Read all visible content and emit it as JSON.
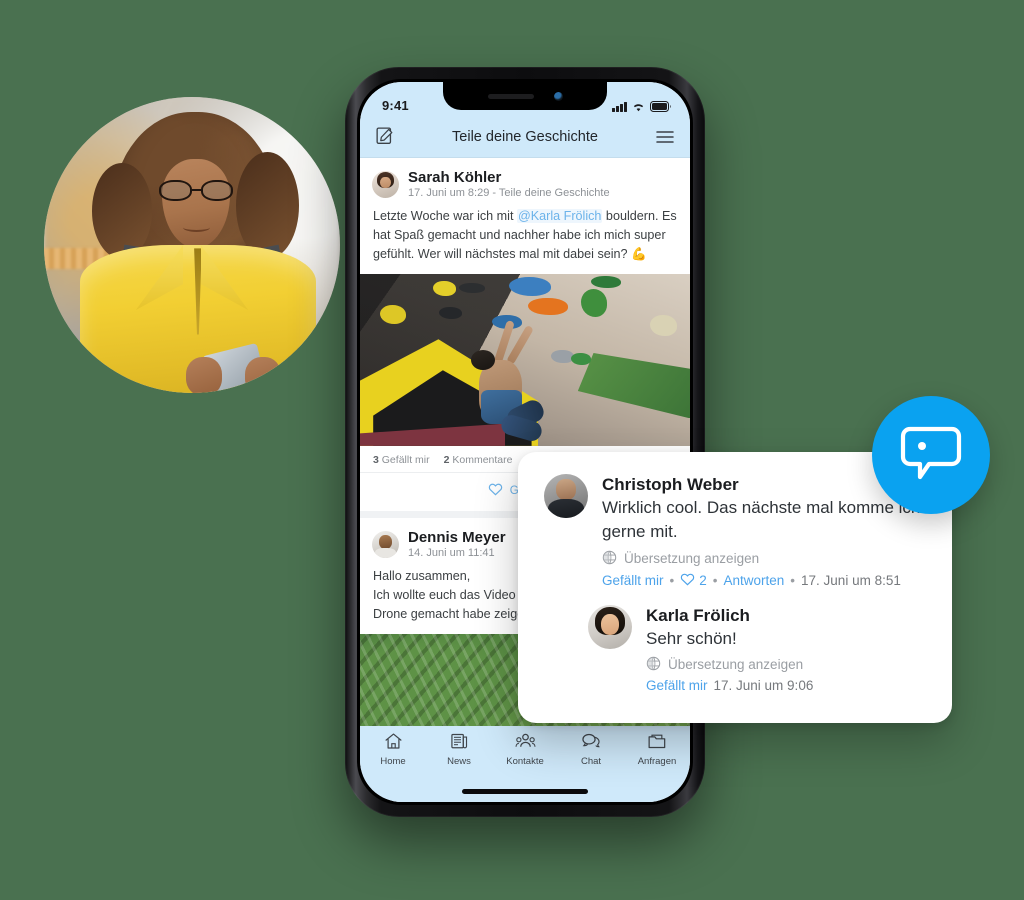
{
  "theme": {
    "page_background": "#4a7150",
    "header_blue": "#cfe9fa",
    "accent_blue": "#4da3ea",
    "fab_blue": "#0aa2f0"
  },
  "photo": {
    "alt": "smiling-woman-with-curly-hair-holding-phone"
  },
  "phone": {
    "status_bar": {
      "time": "9:41",
      "signal_icon": "cellular-bars-icon",
      "wifi_icon": "wifi-icon",
      "battery_icon": "battery-icon"
    },
    "header": {
      "compose_icon": "compose-icon",
      "title": "Teile deine Geschichte",
      "menu_icon": "hamburger-menu-icon"
    },
    "feed": {
      "posts": [
        {
          "author": "Sarah Köhler",
          "meta": "17. Juni um 8:29 - Teile deine Geschichte",
          "text_before": "Letzte Woche war ich mit ",
          "mention": "@Karla Frölich",
          "text_after": " bouldern. Es hat Spaß gemacht und nachher habe ich mich super gefühlt. Wer will nächstes mal mit dabei sein? 💪",
          "image_alt": "bouldering-climbing-wall-photo",
          "likes_count": "3",
          "likes_label": "Gefällt mir",
          "comments_count": "2",
          "comments_label": "Kommentare",
          "action_label": "Gefällt mir",
          "action_icon": "heart-icon"
        },
        {
          "author": "Dennis Meyer",
          "meta": "14. Juni um 11:41",
          "text_line1": "Hallo zusammen,",
          "text_line2": "Ich wollte euch das Video",
          "text_line3": "Drone gemacht habe zeigen",
          "image_alt": "aerial-rice-terraces-photo"
        }
      ]
    },
    "tabbar": [
      {
        "label": "Home",
        "icon": "home-icon"
      },
      {
        "label": "News",
        "icon": "newspaper-icon"
      },
      {
        "label": "Kontakte",
        "icon": "contacts-people-icon"
      },
      {
        "label": "Chat",
        "icon": "chat-bubble-icon"
      },
      {
        "label": "Anfragen",
        "icon": "folder-icon"
      }
    ]
  },
  "comment_card": {
    "comments": [
      {
        "author": "Christoph Weber",
        "text": "Wirklich cool. Das nächste mal komme ich gerne mit.",
        "translate_icon": "globe-icon",
        "translate_label": "Übersetzung anzeigen",
        "like_label": "Gefällt mir",
        "heart_icon": "heart-icon",
        "heart_count": "2",
        "reply_label": "Antworten",
        "timestamp": "17. Juni um 8:51",
        "separator": "•"
      },
      {
        "author": "Karla Frölich",
        "text": "Sehr schön!",
        "translate_icon": "globe-icon",
        "translate_label": "Übersetzung anzeigen",
        "like_label": "Gefällt mir",
        "timestamp": "17. Juni um 9:06"
      }
    ]
  },
  "fab": {
    "icon": "chat-bubble-icon",
    "label": "chat"
  }
}
